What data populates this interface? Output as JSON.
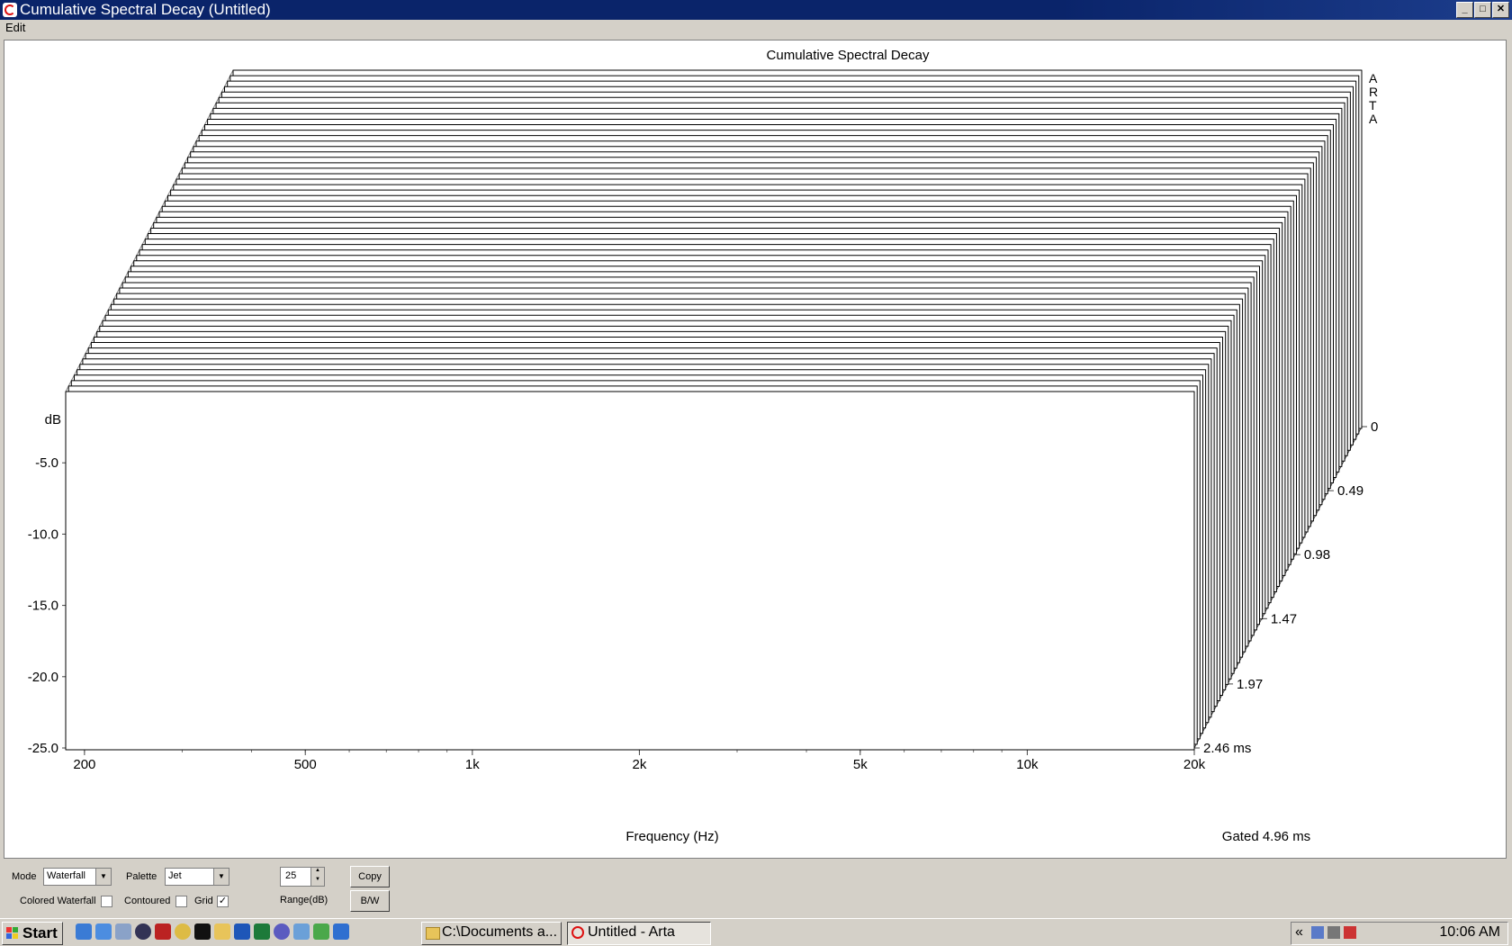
{
  "window": {
    "title": "Cumulative Spectral Decay  (Untitled)",
    "min_label": "_",
    "max_label": "□",
    "close_label": "✕"
  },
  "menu": {
    "edit": "Edit"
  },
  "chart_data": {
    "type": "waterfall",
    "title": "Cumulative Spectral Decay",
    "watermark": "ARTA",
    "xlabel": "Frequency (Hz)",
    "ylabel": "dB",
    "zlabel_note": "Gated 4.96 ms",
    "x_scale": "log",
    "x_ticks": [
      "200",
      "500",
      "1k",
      "2k",
      "5k",
      "10k",
      "20k"
    ],
    "x_tick_values": [
      200,
      500,
      1000,
      2000,
      5000,
      10000,
      20000
    ],
    "xlim": [
      185,
      20000
    ],
    "y_ticks": [
      "-5.0",
      "-10.0",
      "-15.0",
      "-20.0",
      "-25.0"
    ],
    "y_tick_values": [
      -5,
      -10,
      -15,
      -20,
      -25
    ],
    "ylim": [
      -25,
      0
    ],
    "time_ticks": [
      "0",
      "0.49",
      "0.98",
      "1.47",
      "1.97",
      "2.46 ms"
    ],
    "time_tick_values": [
      0,
      0.49,
      0.98,
      1.47,
      1.97,
      2.46
    ],
    "slices": 60,
    "grid": true,
    "palette": "Jet"
  },
  "controls": {
    "mode_label": "Mode",
    "mode_value": "Waterfall",
    "palette_label": "Palette",
    "palette_value": "Jet",
    "range_value": "25",
    "range_label": "Range(dB)",
    "copy_label": "Copy",
    "bw_label": "B/W",
    "colored_waterfall_label": "Colored Waterfall",
    "contoured_label": "Contoured",
    "grid_label": "Grid",
    "grid_checked": "✓"
  },
  "taskbar": {
    "start_label": "Start",
    "tasks": [
      "C:\\Documents a...",
      "Untitled - Arta"
    ],
    "tray_expand": "«",
    "clock": "10:06 AM"
  }
}
